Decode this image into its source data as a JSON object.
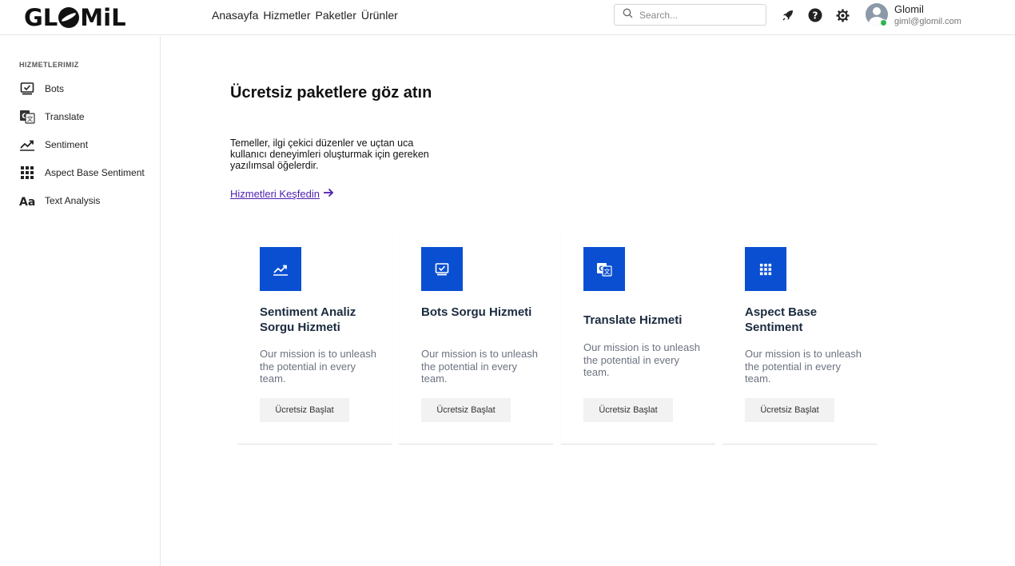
{
  "header": {
    "logo": {
      "part1": "GL",
      "part2": "MiL"
    },
    "nav": [
      "Anasayfa",
      "Hizmetler",
      "Paketler",
      "Ürünler"
    ],
    "search_placeholder": "Search...",
    "icons": [
      "rocket-icon",
      "help-icon",
      "gear-icon"
    ],
    "user": {
      "name": "Glomil",
      "email": "giml@glomil.com",
      "status_color": "#2fb351"
    }
  },
  "sidebar": {
    "title": "HIZMETLERIMIZ",
    "items": [
      {
        "label": "Bots",
        "icon": "bot-monitor-icon"
      },
      {
        "label": "Translate",
        "icon": "translate-icon"
      },
      {
        "label": "Sentiment",
        "icon": "trend-chart-icon"
      },
      {
        "label": "Aspect Base Sentiment",
        "icon": "grid-dots-icon"
      },
      {
        "label": "Text Analysis",
        "icon": "text-aa-icon"
      }
    ]
  },
  "hero": {
    "title": "Ücretsiz paketlere göz atın",
    "text": "Temeller, ilgi çekici düzenler ve uçtan uca kullanıcı deneyimleri oluşturmak için gereken yazılımsal öğelerdir.",
    "link": "Hizmetleri Keşfedin"
  },
  "cards": [
    {
      "title": "Sentiment Analiz Sorgu Hizmeti",
      "desc": "Our mission is to unleash the potential in every team.",
      "button": "Ücretsiz Başlat",
      "icon": "trend-chart-icon"
    },
    {
      "title": "Bots Sorgu Hizmeti",
      "desc": "Our mission is to unleash the potential in every team.",
      "button": "Ücretsiz Başlat",
      "icon": "bot-monitor-icon"
    },
    {
      "title": "Translate Hizmeti",
      "desc": "Our mission is to unleash the potential in every team.",
      "button": "Ücretsiz Başlat",
      "icon": "translate-icon"
    },
    {
      "title": "Aspect Base Sentiment",
      "desc": "Our mission is to unleash the potential in every team.",
      "button": "Ücretsiz Başlat",
      "icon": "grid-dots-icon"
    }
  ],
  "colors": {
    "accent": "#0a4fd1",
    "link": "#4b1fb0"
  }
}
